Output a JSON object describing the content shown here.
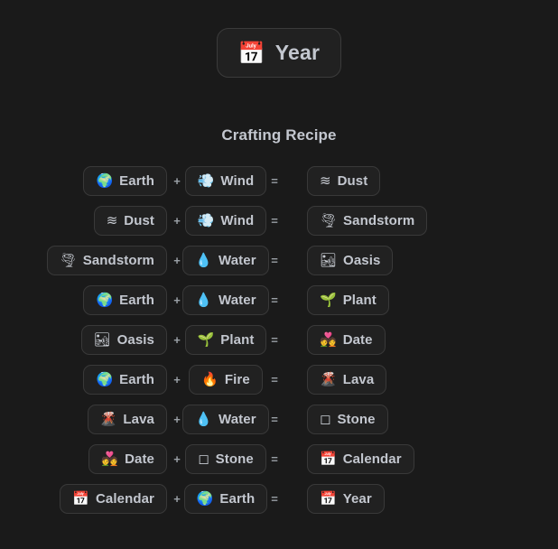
{
  "title": {
    "icon": "calendar-icon",
    "icon_glyph": "📅",
    "label": "Year"
  },
  "section": {
    "heading": "Crafting Recipe"
  },
  "operators": {
    "plus": "+",
    "equals": "="
  },
  "colors": {
    "background": "#1a1a1a",
    "chip_fill": "#212121",
    "chip_border": "#393939",
    "text": "#c3c7cf",
    "operator": "#9aa0a6"
  },
  "recipes": [
    {
      "a": {
        "glyph": "🌍",
        "icon": "earth-icon",
        "label": "Earth"
      },
      "b": {
        "glyph": "💨",
        "icon": "wind-icon",
        "label": "Wind"
      },
      "result": {
        "glyph": "≋",
        "icon": "dust-icon",
        "label": "Dust"
      }
    },
    {
      "a": {
        "glyph": "≋",
        "icon": "dust-icon",
        "label": "Dust"
      },
      "b": {
        "glyph": "💨",
        "icon": "wind-icon",
        "label": "Wind"
      },
      "result": {
        "glyph": "🌪",
        "icon": "sandstorm-icon",
        "label": "Sandstorm"
      }
    },
    {
      "a": {
        "glyph": "🌪",
        "icon": "sandstorm-icon",
        "label": "Sandstorm"
      },
      "b": {
        "glyph": "💧",
        "icon": "water-icon",
        "label": "Water"
      },
      "result": {
        "glyph": "🏜",
        "icon": "oasis-icon",
        "label": "Oasis"
      }
    },
    {
      "a": {
        "glyph": "🌍",
        "icon": "earth-icon",
        "label": "Earth"
      },
      "b": {
        "glyph": "💧",
        "icon": "water-icon",
        "label": "Water"
      },
      "result": {
        "glyph": "🌱",
        "icon": "plant-icon",
        "label": "Plant"
      }
    },
    {
      "a": {
        "glyph": "🏜",
        "icon": "oasis-icon",
        "label": "Oasis"
      },
      "b": {
        "glyph": "🌱",
        "icon": "plant-icon",
        "label": "Plant"
      },
      "result": {
        "glyph": "💑",
        "icon": "date-icon",
        "label": "Date"
      }
    },
    {
      "a": {
        "glyph": "🌍",
        "icon": "earth-icon",
        "label": "Earth"
      },
      "b": {
        "glyph": "🔥",
        "icon": "fire-icon",
        "label": "Fire"
      },
      "result": {
        "glyph": "🌋",
        "icon": "lava-icon",
        "label": "Lava"
      }
    },
    {
      "a": {
        "glyph": "🌋",
        "icon": "lava-icon",
        "label": "Lava"
      },
      "b": {
        "glyph": "💧",
        "icon": "water-icon",
        "label": "Water"
      },
      "result": {
        "glyph": "◻",
        "icon": "stone-icon",
        "label": "Stone"
      }
    },
    {
      "a": {
        "glyph": "💑",
        "icon": "date-icon",
        "label": "Date"
      },
      "b": {
        "glyph": "◻",
        "icon": "stone-icon",
        "label": "Stone"
      },
      "result": {
        "glyph": "📅",
        "icon": "calendar-icon",
        "label": "Calendar"
      }
    },
    {
      "a": {
        "glyph": "📅",
        "icon": "calendar-icon",
        "label": "Calendar"
      },
      "b": {
        "glyph": "🌍",
        "icon": "earth-icon",
        "label": "Earth"
      },
      "result": {
        "glyph": "📅",
        "icon": "year-icon",
        "label": "Year"
      }
    }
  ]
}
